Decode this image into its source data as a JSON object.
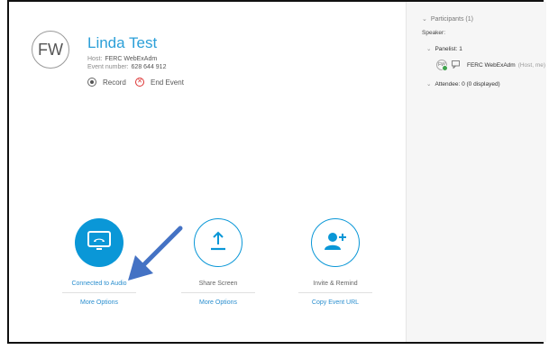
{
  "event": {
    "avatar_initials": "FW",
    "title": "Linda Test",
    "host_label": "Host:",
    "host_value": "FERC WebExAdm",
    "event_number_label": "Event number:",
    "event_number_value": "628 644 912",
    "record_label": "Record",
    "end_label": "End Event",
    "end_icon_glyph": "✕"
  },
  "controls": {
    "audio": {
      "label": "Connected to Audio",
      "link": "More Options",
      "icon": "phone-hangup-icon"
    },
    "share": {
      "label": "Share Screen",
      "link": "More Options",
      "icon": "upload-arrow-icon"
    },
    "invite": {
      "label": "Invite & Remind",
      "link": "Copy Event URL",
      "icon": "add-person-icon"
    }
  },
  "participants": {
    "title": "Participants (1)",
    "speaker": "Speaker:",
    "panelist_group": "Panelist: 1",
    "host_initials": "FW",
    "host_name": "FERC WebExAdm",
    "host_suffix": "(Host, me)",
    "attendee_group": "Attendee: 0 (0 displayed)",
    "chevron_glyph": "⌄"
  },
  "colors": {
    "accent": "#0a97d7",
    "link": "#2b8fcf",
    "end_event": "#d33333",
    "annotation_arrow": "#4472c4"
  }
}
